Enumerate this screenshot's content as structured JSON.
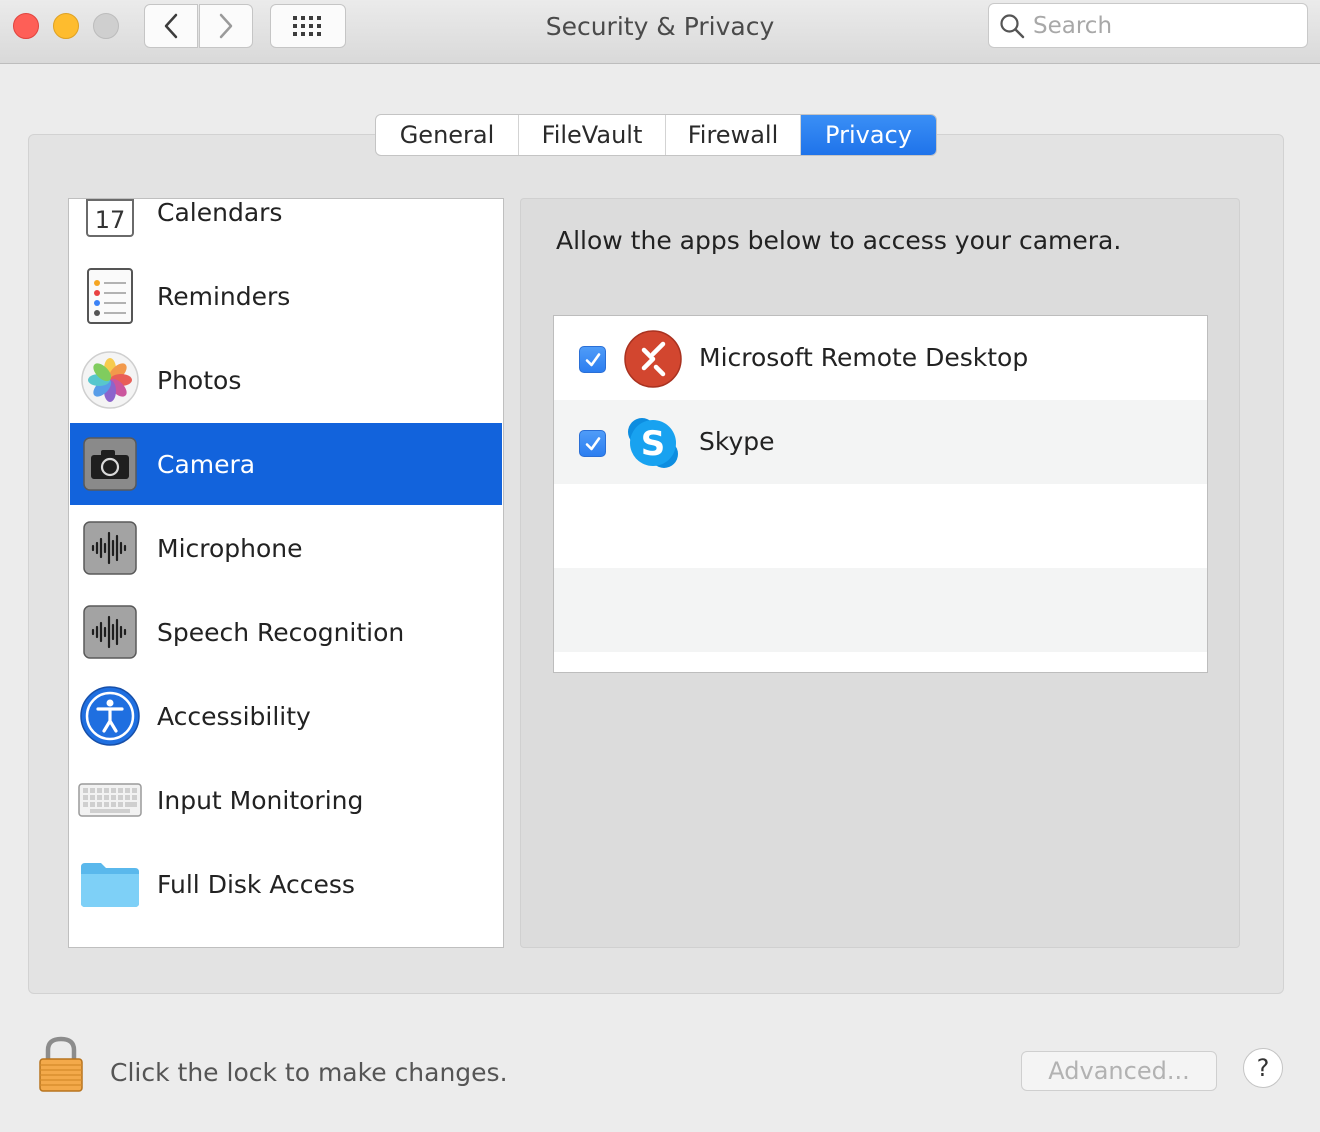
{
  "window": {
    "title": "Security & Privacy"
  },
  "search": {
    "placeholder": "Search"
  },
  "tabs": [
    {
      "label": "General"
    },
    {
      "label": "FileVault"
    },
    {
      "label": "Firewall"
    },
    {
      "label": "Privacy"
    }
  ],
  "sidebar": {
    "items": [
      {
        "label": "Calendars",
        "icon": "calendar-icon",
        "icon_text": "17"
      },
      {
        "label": "Reminders",
        "icon": "reminders-icon"
      },
      {
        "label": "Photos",
        "icon": "photos-icon"
      },
      {
        "label": "Camera",
        "icon": "camera-icon"
      },
      {
        "label": "Microphone",
        "icon": "microphone-icon"
      },
      {
        "label": "Speech Recognition",
        "icon": "speech-recognition-icon"
      },
      {
        "label": "Accessibility",
        "icon": "accessibility-icon"
      },
      {
        "label": "Input Monitoring",
        "icon": "keyboard-icon"
      },
      {
        "label": "Full Disk Access",
        "icon": "folder-icon"
      }
    ],
    "selected": "Camera"
  },
  "panel": {
    "heading": "Allow the apps below to access your camera.",
    "apps": [
      {
        "name": "Microsoft Remote Desktop",
        "checked": true,
        "icon": "remote-desktop-icon"
      },
      {
        "name": "Skype",
        "checked": true,
        "icon": "skype-icon"
      }
    ]
  },
  "footer": {
    "lock_text": "Click the lock to make changes.",
    "advanced_label": "Advanced...",
    "help_label": "?"
  },
  "colors": {
    "accent": "#1263dc",
    "tab_active": "#2a7ff0"
  }
}
